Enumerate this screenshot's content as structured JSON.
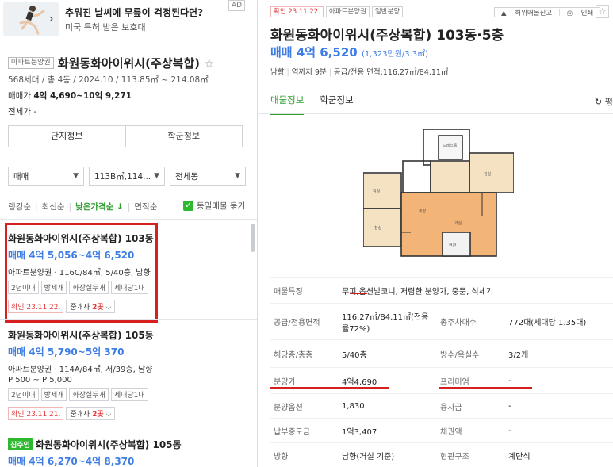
{
  "ad": {
    "title": "추워진 날씨에 무릎이 걱정된다면?",
    "subtitle": "미국 특허 받은 보호대",
    "badge": "AD"
  },
  "complex": {
    "tag": "아파트분양권",
    "name": "화원동화아이위시(주상복합)",
    "meta": "568세대 / 총 4동 / 2024.10 / 113.85㎡ ~ 214.08㎡",
    "price_label": "매매가",
    "price_value": "4억 4,690~10억 9,271",
    "jeonse": "전세가 -"
  },
  "info_buttons": [
    "단지정보",
    "학군정보"
  ],
  "filters": [
    "매매",
    "113B㎡,114...",
    "전체동"
  ],
  "sort": {
    "items": [
      "랭킹순",
      "최신순",
      "낮은가격순 ↓",
      "면적순"
    ],
    "active_index": 2,
    "same_listing": "동일매물 묶기"
  },
  "listings": [
    {
      "title": "화원동화아이위시(주상복합) 103동",
      "price": "매매 4억 5,056~4억 6,520",
      "desc": "아파트분양권 · 116C/84㎡, 5/40층, 남향",
      "tags": [
        "2년이내",
        "방세개",
        "화장실두개",
        "세대당1대"
      ],
      "confirm": "확인 23.11.22.",
      "agent_prefix": "중개사",
      "agent_count": "2곳"
    },
    {
      "title": "화원동화아이위시(주상복합) 105동",
      "price": "매매 4억 5,790~5억 370",
      "desc": "아파트분양권 · 114A/84㎡, 저/39층, 남향",
      "desc2": "P 500 ~ P 5,000",
      "tags": [
        "2년이내",
        "방세개",
        "화장실두개",
        "세대당1대"
      ],
      "confirm": "확인 23.11.21.",
      "agent_prefix": "중개사",
      "agent_count": "2곳"
    },
    {
      "badge": "집주인",
      "title": "화원동화아이위시(주상복합) 105동",
      "price": "매매 4억 6,270~4억 8,370"
    }
  ],
  "detail": {
    "tags": [
      "확인 23.11.22.",
      "아파트분양권",
      "일반분양"
    ],
    "actions": {
      "report": "허위매물신고",
      "print": "인쇄"
    },
    "title": "화원동화아이위시(주상복합) 103동·5층",
    "price": "매매 4억 6,520",
    "price_per": "(1,323만원/3.3㎡)",
    "summary": [
      "남향",
      "역까지 9분",
      "공급/전용 면적:116.27㎡/84.11㎡"
    ],
    "tabs": [
      "매물정보",
      "학군정보"
    ],
    "refresh": "평",
    "floorplan_labels": [
      "침실",
      "드레스룸",
      "침실",
      "거실",
      "주방",
      "침실",
      "현관"
    ],
    "rows": [
      {
        "label": "매물특징",
        "value": "무피,옵션발코니, 저렴한 분양가, 중문, 식세기"
      },
      {
        "label": "공급/전용면적",
        "value": "116.27㎡/84.11㎡(전용률72%)",
        "label2": "총주차대수",
        "value2": "772대(세대당 1.35대)"
      },
      {
        "label": "해당층/총층",
        "value": "5/40층",
        "label2": "방수/욕실수",
        "value2": "3/2개"
      },
      {
        "label": "분양가",
        "value": "4억4,690",
        "label2": "프리미엄",
        "value2": "-"
      },
      {
        "label": "분양옵션",
        "value": "1,830",
        "label2": "융자금",
        "value2": "-"
      },
      {
        "label": "납부중도금",
        "value": "1억3,407",
        "label2": "채권액",
        "value2": "-"
      },
      {
        "label": "방향",
        "value": "남향(거실 기준)",
        "label2": "현관구조",
        "value2": "계단식"
      }
    ]
  },
  "icons": {
    "chevron": "chevron-down-icon",
    "star": "star-icon",
    "check": "check-icon",
    "refresh": "refresh-icon"
  },
  "colors": {
    "accent_green": "#2a9d2a",
    "price_blue": "#3d7de4",
    "alert_red": "#e23c3c",
    "annotation_red": "#d62020"
  }
}
